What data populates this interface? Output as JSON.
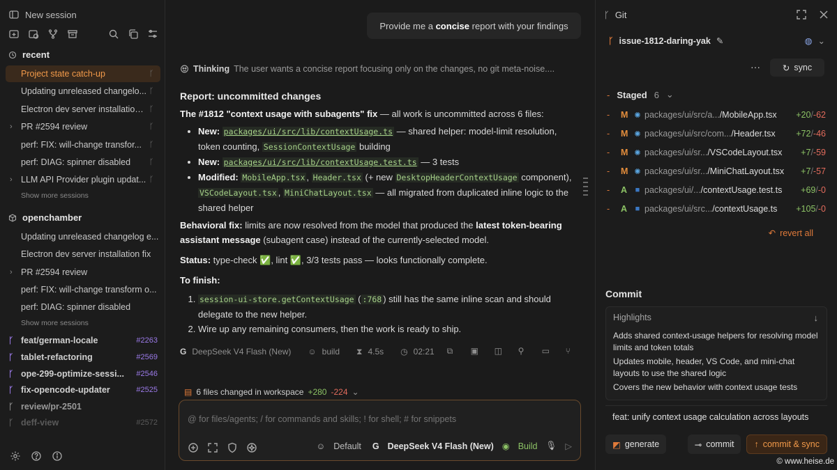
{
  "sidebar": {
    "new_session": "New session",
    "recent_title": "recent",
    "recent_items": [
      {
        "label": "Project state catch-up",
        "active": true,
        "chev": false
      },
      {
        "label": "Updating unreleased changelo...",
        "active": false,
        "chev": false
      },
      {
        "label": "Electron dev server installation...",
        "active": false,
        "chev": false
      },
      {
        "label": "PR #2594 review",
        "active": false,
        "chev": true
      },
      {
        "label": "perf: FIX: will-change transfor...",
        "active": false,
        "chev": false
      },
      {
        "label": "perf: DIAG: spinner disabled",
        "active": false,
        "chev": false
      },
      {
        "label": "LLM API Provider plugin updat...",
        "active": false,
        "chev": true
      }
    ],
    "show_more": "Show more sessions",
    "project_title": "openchamber",
    "project_items": [
      {
        "label": "Updating unreleased changelog e...",
        "chev": false
      },
      {
        "label": "Electron dev server installation fix",
        "chev": false
      },
      {
        "label": "PR #2594 review",
        "chev": true
      },
      {
        "label": "perf: FIX: will-change transform o...",
        "chev": false
      },
      {
        "label": "perf: DIAG: spinner disabled",
        "chev": false
      }
    ],
    "show_more_2": "Show more sessions",
    "branches": [
      {
        "name": "feat/german-locale",
        "pr": "#2263"
      },
      {
        "name": "tablet-refactoring",
        "pr": "#2569"
      },
      {
        "name": "ope-299-optimize-sessi...",
        "pr": "#2546"
      },
      {
        "name": "fix-opencode-updater",
        "pr": "#2525"
      },
      {
        "name": "review/pr-2501",
        "pr": ""
      },
      {
        "name": "deff-view",
        "pr": "#2572"
      }
    ]
  },
  "chat": {
    "user_prefix": "Provide me a ",
    "user_bold": "concise",
    "user_suffix": " report with your findings",
    "thinking_label": "Thinking",
    "thinking_text": "The user wants a concise report focusing only on the changes, no git meta-noise....",
    "report_title": "Report: uncommitted changes",
    "intro_bold": "The #1812 \"context usage with subagents\" fix",
    "intro_rest": " — all work is uncommitted across 6 files:",
    "b1_label": "New: ",
    "b1_code": "packages/ui/src/lib/contextUsage.ts",
    "b1_text": " — shared helper: model-limit resolution, token counting, ",
    "b1_code2": "SessionContextUsage",
    "b1_text2": " building",
    "b2_label": "New: ",
    "b2_code": "packages/ui/src/lib/contextUsage.test.ts",
    "b2_text": " — 3 tests",
    "b3_label": "Modified: ",
    "b3_c1": "MobileApp.tsx",
    "b3_sep1": ", ",
    "b3_c2": "Header.tsx",
    "b3_t1": " (+ new ",
    "b3_c3": "DesktopHeaderContextUsage",
    "b3_t2": " component), ",
    "b3_c4": "VSCodeLayout.tsx",
    "b3_sep2": ", ",
    "b3_c5": "MiniChatLayout.tsx",
    "b3_t3": " — all migrated from duplicated inline logic to the shared helper",
    "beh_label": "Behavioral fix:",
    "beh_text": " limits are now resolved from the model that produced the ",
    "beh_bold": "latest token-bearing assistant message",
    "beh_text2": " (subagent case) instead of the currently-selected model.",
    "status_label": "Status:",
    "status_text": " type-check ✅, lint ✅, 3/3 tests pass — looks functionally complete.",
    "finish_label": "To finish:",
    "f1_code": "session-ui-store.getContextUsage",
    "f1_t1": " (",
    "f1_code2": ":768",
    "f1_t2": ") still has the same inline scan and should delegate to the new helper.",
    "f2_text": "Wire up any remaining consumers, then the work is ready to ship.",
    "meta_model": "DeepSeek V4 Flash (New)",
    "meta_mode": "build",
    "meta_dur": "4.5s",
    "meta_time": "02:21",
    "files_changed": "6 files changed in workspace",
    "files_add": "+280",
    "files_del": "-224",
    "input_placeholder": "@ for files/agents; / for commands and skills; ! for shell; # for snippets",
    "opt_default": "Default",
    "opt_model": "DeepSeek V4 Flash (New)",
    "opt_build": "Build"
  },
  "git": {
    "title": "Git",
    "branch": "issue-1812-daring-yak",
    "dots": "···",
    "sync": "sync",
    "staged_label": "Staged",
    "staged_count": "6",
    "files": [
      {
        "status": "M",
        "path": "packages/ui/src/a...",
        "name": "/MobileApp.tsx",
        "add": "+20",
        "del": "-62"
      },
      {
        "status": "M",
        "path": "packages/ui/src/com...",
        "name": "/Header.tsx",
        "add": "+72",
        "del": "-46"
      },
      {
        "status": "M",
        "path": "packages/ui/sr...",
        "name": "/VSCodeLayout.tsx",
        "add": "+7",
        "del": "-59"
      },
      {
        "status": "M",
        "path": "packages/ui/sr...",
        "name": "/MiniChatLayout.tsx",
        "add": "+7",
        "del": "-57"
      },
      {
        "status": "A",
        "path": "packages/ui/...",
        "name": "/contextUsage.test.ts",
        "add": "+69",
        "del": "-0"
      },
      {
        "status": "A",
        "path": "packages/ui/src...",
        "name": "/contextUsage.ts",
        "add": "+105",
        "del": "-0"
      }
    ],
    "revert_all": "revert all",
    "commit_title": "Commit",
    "highlights_label": "Highlights",
    "highlights": [
      "Adds shared context-usage helpers for resolving model limits and token totals",
      "Updates mobile, header, VS Code, and mini-chat layouts to use the shared logic",
      "Covers the new behavior with context usage tests"
    ],
    "commit_message": "feat: unify context usage calculation across layouts",
    "generate": "generate",
    "commit": "commit",
    "commit_sync": "commit & sync"
  },
  "watermark": "© www.heise.de"
}
